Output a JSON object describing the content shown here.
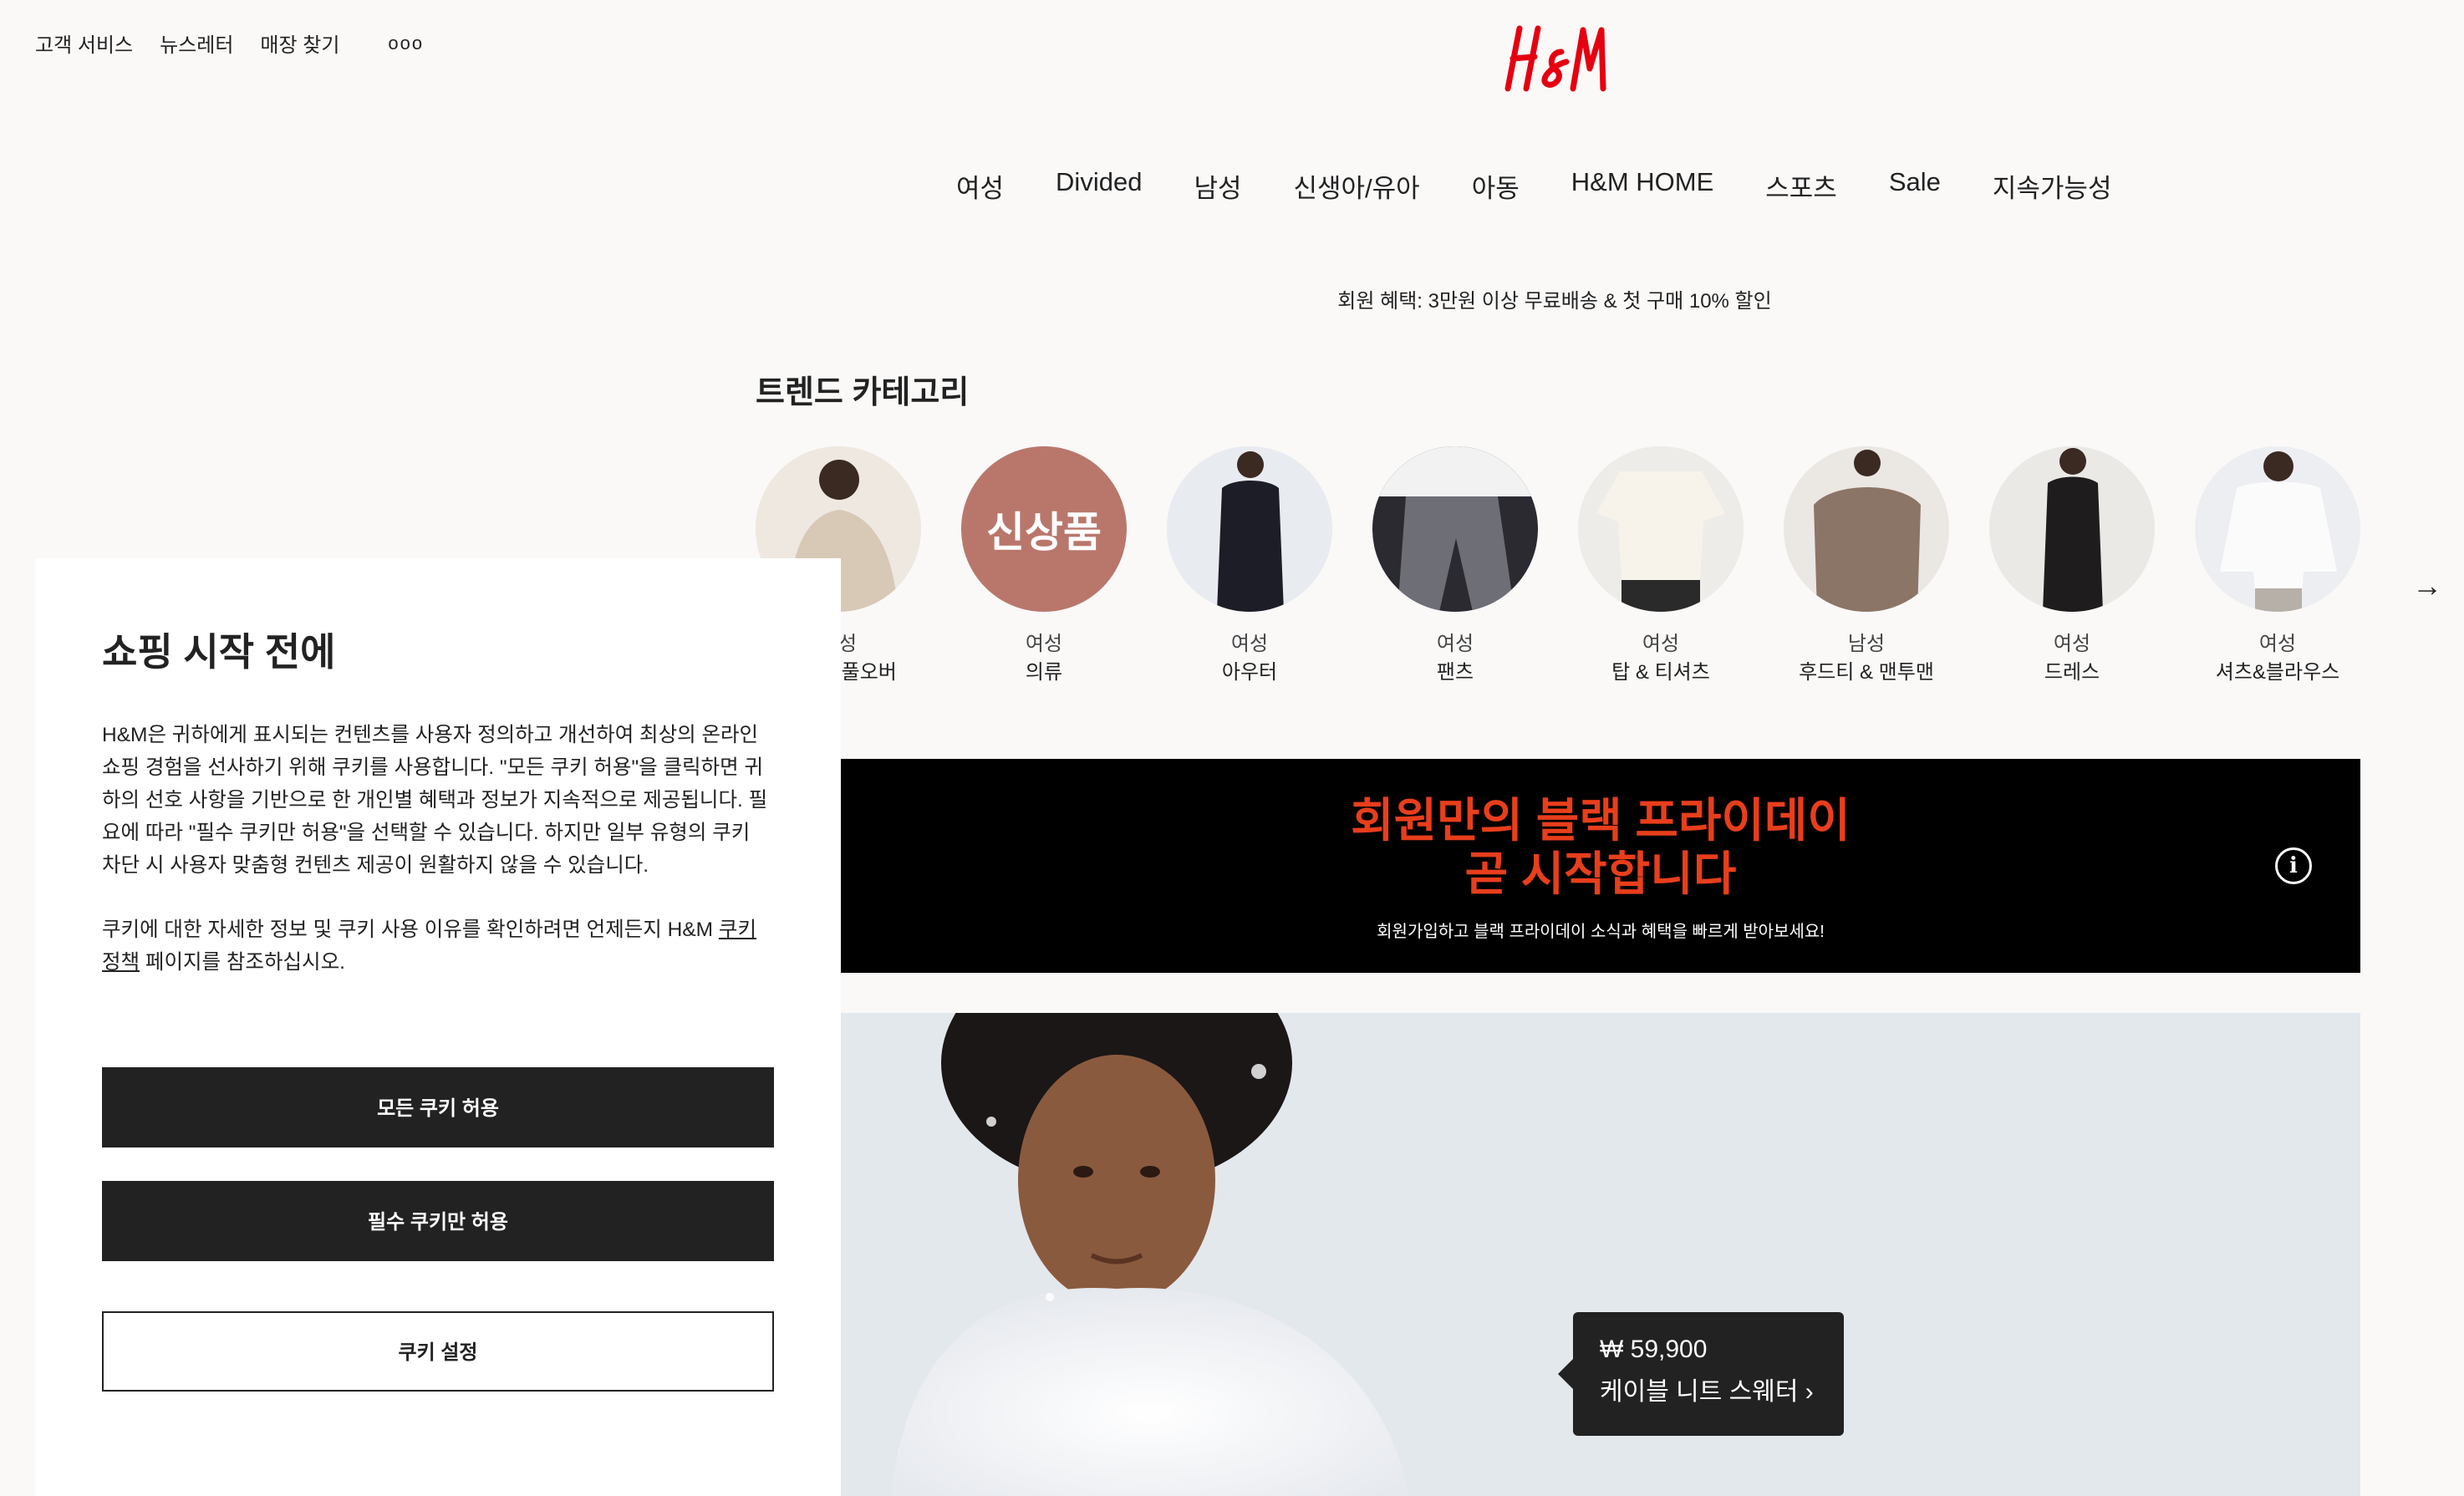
{
  "utility": [
    "고객 서비스",
    "뉴스레터",
    "매장 찾기"
  ],
  "utility_more": "ooo",
  "brand": {
    "accent": "#e50010"
  },
  "nav": [
    "여성",
    "Divided",
    "남성",
    "신생아/유아",
    "아동",
    "H&M HOME",
    "스포츠",
    "Sale",
    "지속가능성"
  ],
  "promo": "회원 혜택: 3만원 이상 무료배송 & 첫 구매 10% 할인",
  "trend_title": "트렌드 카테고리",
  "categories": [
    {
      "group": "여성",
      "name": "니트 & 풀오버",
      "icon": "sweater-photo"
    },
    {
      "group": "여성",
      "name": "의류",
      "badge": "신상품"
    },
    {
      "group": "여성",
      "name": "아우터",
      "icon": "coat-photo"
    },
    {
      "group": "여성",
      "name": "팬츠",
      "icon": "pants-photo"
    },
    {
      "group": "여성",
      "name": "탑 & 티셔츠",
      "icon": "tshirt-photo"
    },
    {
      "group": "남성",
      "name": "후드티 & 맨투맨",
      "icon": "hoodie-photo"
    },
    {
      "group": "여성",
      "name": "드레스",
      "icon": "dress-photo"
    },
    {
      "group": "여성",
      "name": "셔츠&블라우스",
      "icon": "blouse-photo"
    }
  ],
  "banner": {
    "line1": "회원만의 블랙 프라이데이",
    "line2": "곧 시작합니다",
    "sub": "회원가입하고 블랙 프라이데이 소식과 혜택을 빠르게 받아보세요!",
    "info": "i"
  },
  "product": {
    "price": "₩ 59,900",
    "title": "케이블 니트 스웨터 ›"
  },
  "cookie": {
    "title": "쇼핑 시작 전에",
    "para1": "H&M은 귀하에게 표시되는 컨텐츠를 사용자 정의하고 개선하여 최상의 온라인 쇼핑 경험을 선사하기 위해 쿠키를 사용합니다. \"모든 쿠키 허용\"을 클릭하면 귀하의 선호 사항을 기반으로 한 개인별 혜택과 정보가 지속적으로 제공됩니다. 필요에 따라 \"필수 쿠키만 허용\"을 선택할 수 있습니다. 하지만 일부 유형의 쿠키 차단 시 사용자 맞춤형 컨텐츠 제공이 원활하지 않을 수 있습니다.",
    "para2_before": "쿠키에 대한 자세한 정보 및 쿠키 사용 이유를 확인하려면 언제든지 H&M ",
    "para2_link": "쿠키 정책",
    "para2_after": " 페이지를 참조하십시오.",
    "accept_all": "모든 쿠키 허용",
    "essential_only": "필수 쿠키만 허용",
    "settings": "쿠키 설정"
  }
}
